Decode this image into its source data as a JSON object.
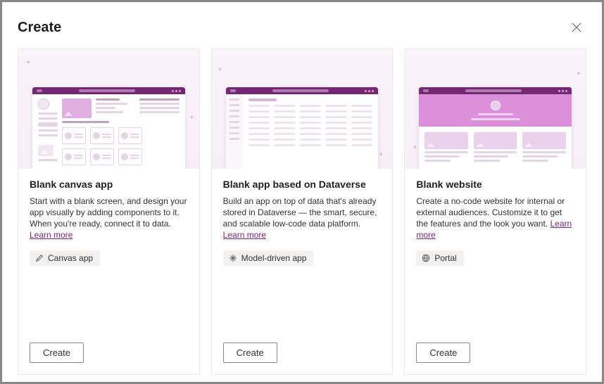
{
  "header": {
    "title": "Create"
  },
  "cards": [
    {
      "title": "Blank canvas app",
      "description": "Start with a blank screen, and design your app visually by adding components to it. When you're ready, connect it to data.",
      "learnMore": "Learn more",
      "badge": {
        "icon": "pencil-icon",
        "label": "Canvas app"
      },
      "button": "Create"
    },
    {
      "title": "Blank app based on Dataverse",
      "description": "Build an app on top of data that's already stored in Dataverse — the smart, secure, and scalable low-code data platform.",
      "learnMore": "Learn more",
      "badge": {
        "icon": "arrows-icon",
        "label": "Model-driven app"
      },
      "button": "Create"
    },
    {
      "title": "Blank website",
      "description": "Create a no-code website for internal or external audiences. Customize it to get the features and the look you want.",
      "learnMore": "Learn more",
      "badge": {
        "icon": "globe-icon",
        "label": "Portal"
      },
      "button": "Create"
    }
  ]
}
